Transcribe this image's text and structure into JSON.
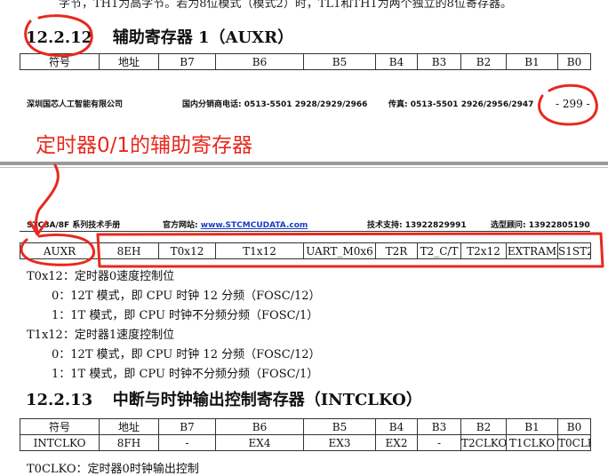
{
  "top_text": "字节，TH1为高字节。若为8位模式（模式2）时，TL1和TH1为两个独立的8位寄存器。",
  "section1": {
    "number": "12.2.12",
    "title": "辅助寄存器 1（AUXR）"
  },
  "table1": {
    "cells": [
      "符号",
      "地址",
      "B7",
      "B6",
      "B5",
      "B4",
      "B3",
      "B2",
      "B1",
      "B0"
    ]
  },
  "footer": {
    "company": "深圳国芯人工智能有限公司",
    "sales_phone": "国内分销商电话: 0513-5501 2928/2929/2966",
    "fax": "传真: 0513-5501 2926/2956/2947",
    "page": "- 299 -"
  },
  "annotation": {
    "text": "定时器0/1的辅助寄存器"
  },
  "header": {
    "series": "STC8A/8F 系列技术手册",
    "website_label": "官方网站:",
    "website": "www.STCMCUDATA.com",
    "support": "技术支持: 13922829991",
    "sample": "选型顾问: 13922805190"
  },
  "table2": {
    "cells": [
      "AUXR",
      "8EH",
      "T0x12",
      "T1x12",
      "UART_M0x6",
      "T2R",
      "T2_C/T",
      "T2x12",
      "EXTRAM",
      "S1ST2"
    ]
  },
  "desc": {
    "t0_title": "T0x12：定时器0速度控制位",
    "t0_opt0": "0：12T 模式，即 CPU 时钟 12 分频（FOSC/12）",
    "t0_opt1": "1：1T 模式，即 CPU 时钟不分频分频（FOSC/1）",
    "t1_title": "T1x12：定时器1速度控制位",
    "t1_opt0": "0：12T 模式，即 CPU 时钟 12 分频（FOSC/12）",
    "t1_opt1": "1：1T 模式，即 CPU 时钟不分频分频（FOSC/1）"
  },
  "section2": {
    "number": "12.2.13",
    "title": "中断与时钟输出控制寄存器（INTCLKO）"
  },
  "table3": {
    "header": [
      "符号",
      "地址",
      "B7",
      "B6",
      "B5",
      "B4",
      "B3",
      "B2",
      "B1",
      "B0"
    ],
    "row": [
      "INTCLKO",
      "8FH",
      "-",
      "EX4",
      "EX3",
      "EX2",
      "-",
      "T2CLKO",
      "T1CLKO",
      "T0CLKO"
    ]
  },
  "bottom_text": "T0CLKO：定时器0时钟输出控制",
  "colors": {
    "annotation_red": "#e8281e",
    "link_blue": "#1a3cc8"
  }
}
